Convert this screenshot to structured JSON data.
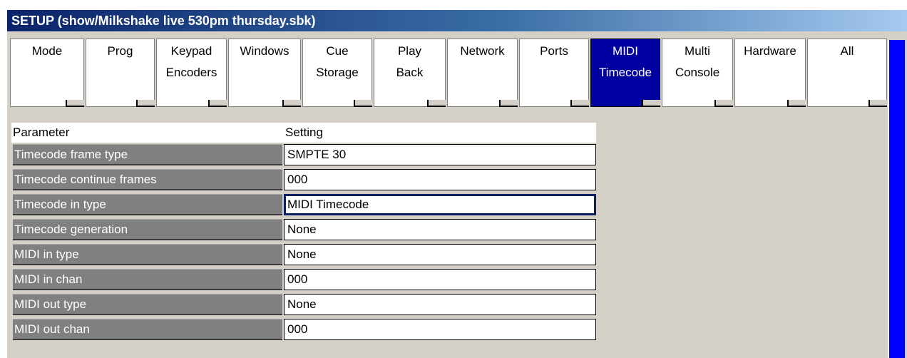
{
  "window": {
    "title": "SETUP (show/Milkshake live 530pm thursday.sbk)"
  },
  "tabs": [
    {
      "line1": "Mode",
      "line2": ""
    },
    {
      "line1": "Prog",
      "line2": ""
    },
    {
      "line1": "Keypad",
      "line2": "Encoders"
    },
    {
      "line1": "Windows",
      "line2": ""
    },
    {
      "line1": "Cue",
      "line2": "Storage"
    },
    {
      "line1": "Play",
      "line2": "Back"
    },
    {
      "line1": "Network",
      "line2": ""
    },
    {
      "line1": "Ports",
      "line2": ""
    },
    {
      "line1": "MIDI",
      "line2": "Timecode",
      "active": true
    },
    {
      "line1": "Multi",
      "line2": "Console"
    },
    {
      "line1": "Hardware",
      "line2": ""
    },
    {
      "line1": "All",
      "line2": ""
    }
  ],
  "table": {
    "header_parameter": "Parameter",
    "header_setting": "Setting",
    "rows": [
      {
        "parameter": "Timecode frame type",
        "setting": "SMPTE 30"
      },
      {
        "parameter": "Timecode continue frames",
        "setting": "000"
      },
      {
        "parameter": "Timecode in type",
        "setting": "MIDI Timecode",
        "selected": true
      },
      {
        "parameter": "Timecode generation",
        "setting": "None"
      },
      {
        "parameter": "MIDI in type",
        "setting": "None"
      },
      {
        "parameter": "MIDI in chan",
        "setting": "000"
      },
      {
        "parameter": "MIDI out type",
        "setting": "None"
      },
      {
        "parameter": "MIDI out chan",
        "setting": "000"
      }
    ]
  },
  "colors": {
    "title_bar": "#0a246a",
    "active_tab": "#0000a0",
    "scrollbar": "#0000ff",
    "parameter_cell": "#808080",
    "window_bg": "#d4d0c8"
  }
}
